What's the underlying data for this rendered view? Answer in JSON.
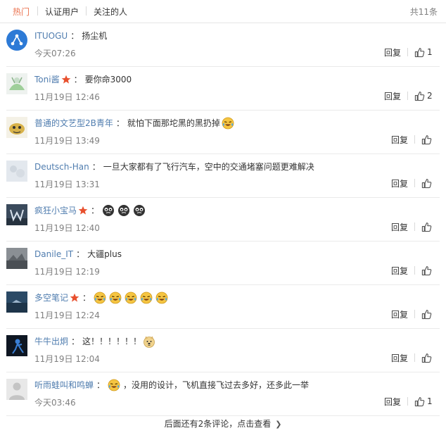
{
  "tabs": {
    "hot": "热门",
    "verified": "认证用户",
    "following": "关注的人",
    "total": "共11条"
  },
  "comments": [
    {
      "name": "ITUOGU",
      "text": "扬尘机",
      "time": "今天07:26",
      "reply": "回复",
      "likes": "1",
      "verified": false,
      "emojis": []
    },
    {
      "name": "Toni酱",
      "text": "要你命3000",
      "time": "11月19日 12:46",
      "reply": "回复",
      "likes": "2",
      "verified": true,
      "emojis": []
    },
    {
      "name": "普通的文艺型2B青年",
      "text": "就怕下面那坨黑的黑扔掉",
      "time": "11月19日 13:49",
      "reply": "回复",
      "likes": "",
      "verified": false,
      "emojis": [
        "laugh-cry"
      ]
    },
    {
      "name": "Deutsch-Han",
      "text": "一旦大家都有了飞行汽车，空中的交通堵塞问题更难解决",
      "time": "11月19日 13:31",
      "reply": "回复",
      "likes": "",
      "verified": false,
      "emojis": []
    },
    {
      "name": "疯狂小宝马",
      "text": "",
      "time": "11月19日 12:40",
      "reply": "回复",
      "likes": "",
      "verified": true,
      "emojis": [
        "black-face",
        "black-face",
        "black-face"
      ]
    },
    {
      "name": "Danile_IT",
      "text": "大疆plus",
      "time": "11月19日 12:19",
      "reply": "回复",
      "likes": "",
      "verified": false,
      "emojis": []
    },
    {
      "name": "多空笔记",
      "text": "",
      "time": "11月19日 12:24",
      "reply": "回复",
      "likes": "",
      "verified": true,
      "emojis": [
        "laugh-cry",
        "laugh-cry",
        "laugh-cry",
        "laugh-cry",
        "laugh-cry"
      ]
    },
    {
      "name": "牛牛出炯",
      "text": "这！！！！！！",
      "time": "11月19日 12:04",
      "reply": "回复",
      "likes": "",
      "verified": false,
      "emojis": [
        "doge"
      ]
    },
    {
      "name": "听雨蛙叫和鸣蝉",
      "text": "，没用的设计，飞机直接飞过去多好，还多此一举",
      "time": "今天03:46",
      "reply": "回复",
      "likes": "1",
      "verified": false,
      "emojis_before": [
        "laugh-cry"
      ]
    }
  ],
  "more": {
    "label": "后面还有2条评论，点击查看"
  },
  "colors": {
    "link": "#507daf",
    "active_tab": "#eb7350",
    "meta": "#808080"
  }
}
